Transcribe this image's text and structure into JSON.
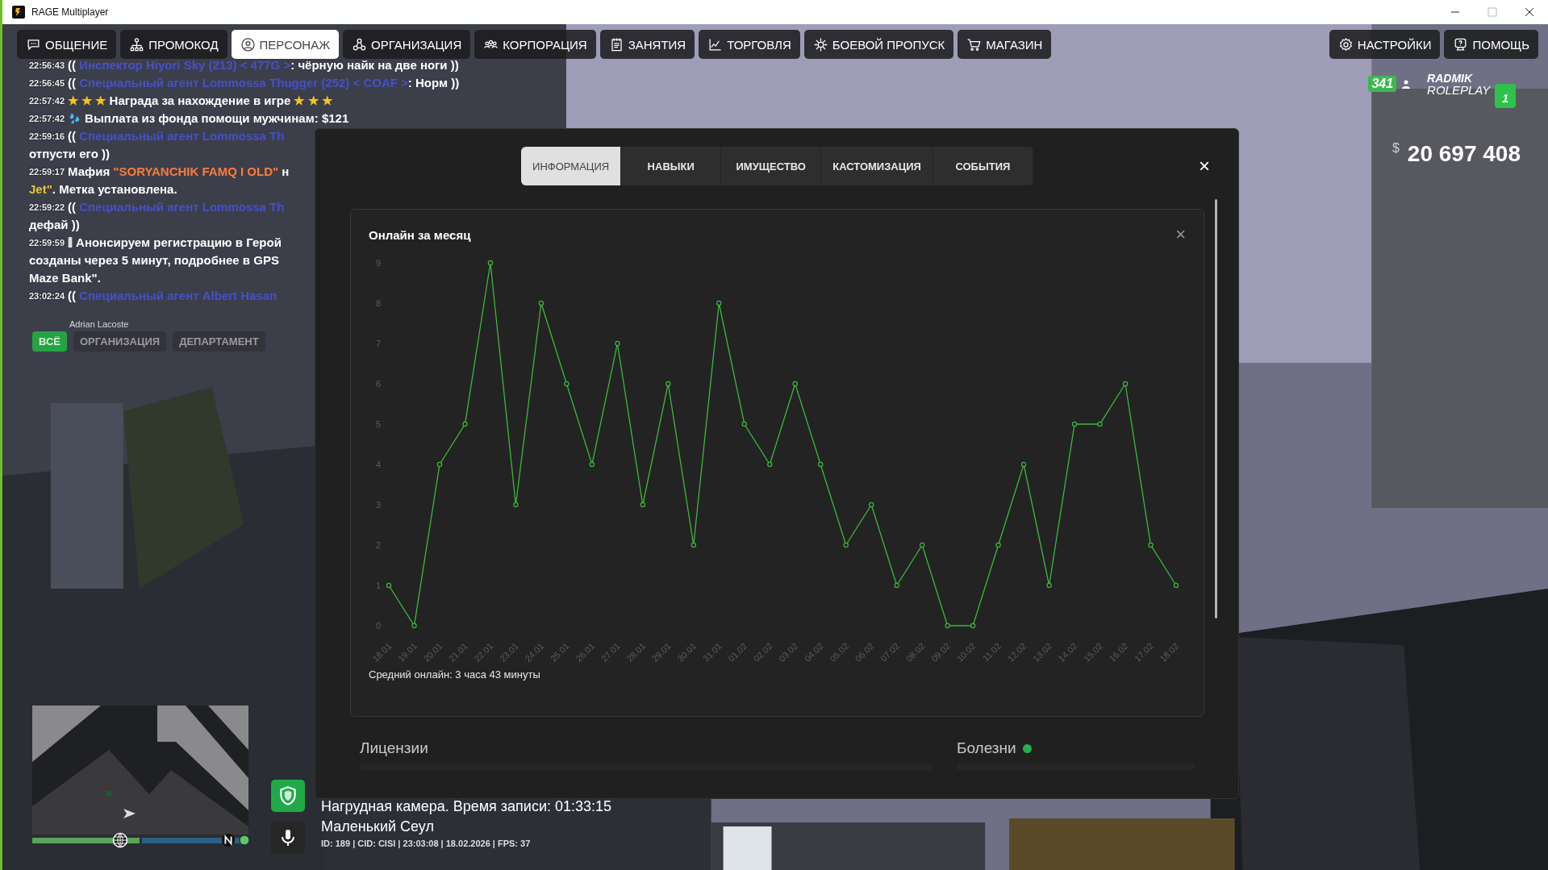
{
  "window": {
    "title": "RAGE Multiplayer"
  },
  "menu": {
    "left": [
      {
        "label": "ОБЩЕНИЕ",
        "selected": false
      },
      {
        "label": "ПРОМОКОД",
        "selected": false
      },
      {
        "label": "ПЕРСОНАЖ",
        "selected": true
      },
      {
        "label": "ОРГАНИЗАЦИЯ",
        "selected": false
      },
      {
        "label": "КОРПОРАЦИЯ",
        "selected": false
      },
      {
        "label": "ЗАНЯТИЯ",
        "selected": false
      },
      {
        "label": "ТОРГОВЛЯ",
        "selected": false
      },
      {
        "label": "БОЕВОЙ ПРОПУСК",
        "selected": false
      },
      {
        "label": "МАГАЗИН",
        "selected": false
      }
    ],
    "right": [
      {
        "label": "НАСТРОЙКИ",
        "selected": false
      },
      {
        "label": "ПОМОЩЬ",
        "selected": false
      }
    ]
  },
  "chat": {
    "messages": [
      {
        "time": "22:56:43",
        "kind": "text",
        "lines": [
          [
            {
              "text": "((",
              "color": "#ffffff"
            },
            {
              "text": " Инспектор Hiyori Sky (213) < 477G >",
              "color": "#4650c8"
            },
            {
              "text": ": чёрную найк на две ноги ))",
              "color": "#ffffff"
            }
          ]
        ]
      },
      {
        "time": "22:56:45",
        "kind": "text",
        "lines": [
          [
            {
              "text": "((",
              "color": "#ffffff"
            },
            {
              "text": " Специальный агент Lommossa Thugger (252) < COAF >",
              "color": "#4650c8"
            },
            {
              "text": ": Норм ))",
              "color": "#ffffff"
            }
          ]
        ]
      },
      {
        "time": "22:57:42",
        "kind": "text",
        "lines": [
          [
            {
              "text": "★ ★ ★",
              "color": "#f5c518"
            },
            {
              "text": " Награда за нахождение в игре ",
              "color": "#ffffff"
            },
            {
              "text": "★ ★ ★",
              "color": "#f5c518"
            }
          ]
        ]
      },
      {
        "time": "22:57:42",
        "kind": "payment",
        "lines": [
          [
            {
              "text": "Выплата из фонда помощи мужчинам: $121",
              "color": "#ffffff"
            }
          ]
        ]
      },
      {
        "time": "22:59:16",
        "kind": "text",
        "lines": [
          [
            {
              "text": "((",
              "color": "#ffffff"
            },
            {
              "text": " Специальный агент Lommossa Th",
              "color": "#4650c8"
            }
          ],
          [
            {
              "text": "отпусти его ))",
              "color": "#ffffff"
            }
          ]
        ]
      },
      {
        "time": "22:59:17",
        "kind": "text",
        "lines": [
          [
            {
              "text": "Мафия ",
              "color": "#ffffff"
            },
            {
              "text": "\"SORYANCHIK FAMQ I OLD\"",
              "color": "#ff7a3d"
            },
            {
              "text": " н",
              "color": "#ffffff"
            }
          ],
          [
            {
              "text": "Jet\"",
              "color": "#e8c23a"
            },
            {
              "text": ". Метка установлена.",
              "color": "#ffffff"
            }
          ]
        ]
      },
      {
        "time": "22:59:22",
        "kind": "text",
        "lines": [
          [
            {
              "text": "((",
              "color": "#ffffff"
            },
            {
              "text": " Специальный агент Lommossa Th",
              "color": "#4650c8"
            }
          ],
          [
            {
              "text": "дефай ))",
              "color": "#ffffff"
            }
          ]
        ]
      },
      {
        "time": "22:59:59",
        "kind": "announcement",
        "lines": [
          [
            {
              "text": "Анонсируем регистрацию в Герой",
              "color": "#ffffff"
            }
          ],
          [
            {
              "text": "созданы через 5 минут, подробнее в GPS",
              "color": "#ffffff"
            }
          ],
          [
            {
              "text": "Maze Bank\".",
              "color": "#ffffff"
            }
          ]
        ]
      },
      {
        "time": "23:02:24",
        "kind": "text",
        "lines": [
          [
            {
              "text": "((",
              "color": "#ffffff"
            },
            {
              "text": " Специальный агент Albert Hasan",
              "color": "#4650c8"
            }
          ]
        ]
      }
    ],
    "tabs": [
      {
        "label": "ВСЁ",
        "selected": true
      },
      {
        "label": "ОРГАНИЗАЦИЯ",
        "selected": false
      },
      {
        "label": "ДЕПАРТАМЕНТ",
        "selected": false
      }
    ],
    "typing_name": "Adrian Lacoste"
  },
  "server": {
    "logo_line1": "RADMIK",
    "logo_line2": "ROLEPLAY",
    "online": "341",
    "badge": "1"
  },
  "money": {
    "currency": "$",
    "amount": "20 697 408"
  },
  "modal": {
    "tabs": [
      {
        "label": "ИНФОРМАЦИЯ",
        "selected": true
      },
      {
        "label": "НАВЫКИ",
        "selected": false
      },
      {
        "label": "ИМУЩЕСТВО",
        "selected": false
      },
      {
        "label": "КАСТОМИЗАЦИЯ",
        "selected": false
      },
      {
        "label": "СОБЫТИЯ",
        "selected": false
      }
    ],
    "close": "×",
    "chart_card": {
      "title": "Онлайн за месяц",
      "close": "×",
      "chart_data": {
        "type": "line",
        "categories": [
          "18.01",
          "19.01",
          "20.01",
          "21.01",
          "22.01",
          "23.01",
          "24.01",
          "25.01",
          "26.01",
          "27.01",
          "28.01",
          "29.01",
          "30.01",
          "31.01",
          "01.02",
          "02.02",
          "03.02",
          "04.02",
          "05.02",
          "06.02",
          "07.02",
          "08.02",
          "09.02",
          "10.02",
          "11.02",
          "12.02",
          "13.02",
          "14.02",
          "15.02",
          "16.02",
          "17.02",
          "18.02"
        ],
        "series": [
          {
            "color": "#3db83d",
            "marker": "circle",
            "values": [
              1,
              0,
              4,
              5,
              9,
              3,
              8,
              6,
              4,
              7,
              3,
              6,
              2,
              8,
              5,
              4,
              6,
              4,
              2,
              3,
              1,
              2,
              0,
              0,
              2,
              4,
              1,
              5,
              5,
              6,
              2,
              1
            ]
          }
        ],
        "ylim": [
          0,
          9
        ],
        "yticks": [
          0,
          1,
          2,
          3,
          4,
          5,
          6,
          7,
          8,
          9
        ]
      },
      "average": "Средний онлайн: 3 часа 43 минуты"
    },
    "sections": [
      {
        "title": "Лицензии"
      },
      {
        "title": "Болезни",
        "color": "#22b14c"
      }
    ]
  },
  "hud": {
    "minimap": {
      "kind": "picture",
      "health": {
        "level": 1
      },
      "armor": {
        "level": 1
      }
    },
    "camera": "Нагрудная камера. Время записи: 01:33:15",
    "zone": "Маленький Сеул",
    "info": "ID: 189 | CID: CISI | 23:03:08 | 18.02.2026 | FPS: 37"
  }
}
